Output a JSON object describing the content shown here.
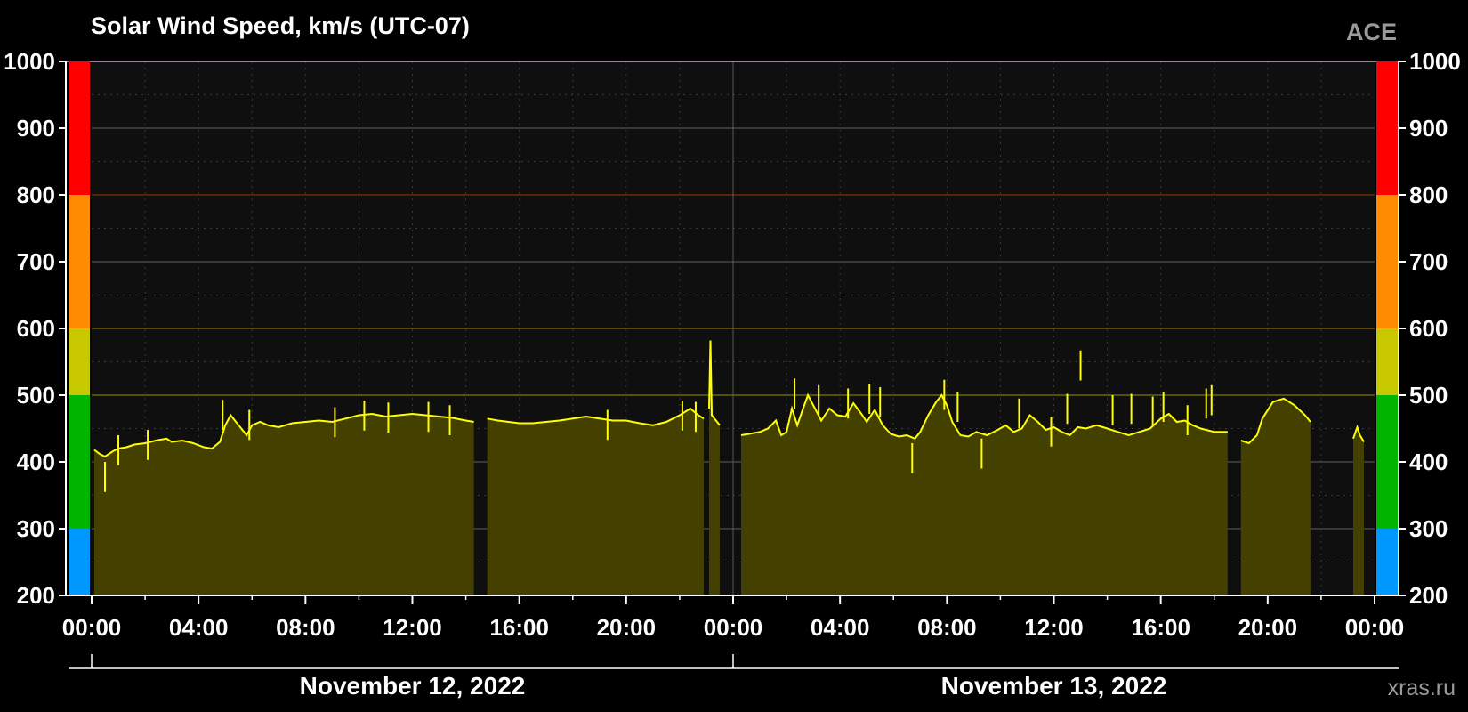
{
  "header": {
    "title": "Solar Wind Speed, km/s (UTC-07)",
    "source": "ACE",
    "credit": "xras.ru"
  },
  "chart_data": {
    "type": "area",
    "title": "Solar Wind Speed, km/s (UTC-07)",
    "xlabel": "",
    "ylabel": "",
    "ylim": [
      200,
      1000
    ],
    "xlim_hours": [
      0,
      48
    ],
    "yticks": [
      200,
      300,
      400,
      500,
      600,
      700,
      800,
      900,
      1000
    ],
    "xtick_labels": [
      "00:00",
      "04:00",
      "08:00",
      "12:00",
      "16:00",
      "20:00",
      "00:00",
      "04:00",
      "08:00",
      "12:00",
      "16:00",
      "20:00",
      "00:00"
    ],
    "date_labels": [
      "November 12, 2022",
      "November 13, 2022"
    ],
    "grid": true,
    "colors": {
      "line": "#ffff00",
      "fill": "#434000",
      "plot_bg": "#0f0f0f",
      "grid": "#505050",
      "threshold_800": "#8a2a00",
      "threshold_600": "#8a6a00",
      "threshold_500": "#7a7a00"
    },
    "thresholds": [
      500,
      600,
      800
    ],
    "color_bands": [
      {
        "from": 200,
        "to": 300,
        "color": "#0099ff"
      },
      {
        "from": 300,
        "to": 500,
        "color": "#00b400"
      },
      {
        "from": 500,
        "to": 600,
        "color": "#c8c800"
      },
      {
        "from": 600,
        "to": 800,
        "color": "#ff8c00"
      },
      {
        "from": 800,
        "to": 1000,
        "color": "#ff0000"
      }
    ],
    "series": [
      {
        "points": [
          [
            0.1,
            418
          ],
          [
            0.3,
            412
          ],
          [
            0.5,
            408
          ],
          [
            0.8,
            416
          ],
          [
            1.0,
            420
          ],
          [
            1.3,
            422
          ],
          [
            1.6,
            426
          ],
          [
            2.0,
            428
          ],
          [
            2.4,
            432
          ],
          [
            2.8,
            435
          ],
          [
            3.0,
            430
          ],
          [
            3.4,
            432
          ],
          [
            3.8,
            428
          ],
          [
            4.2,
            422
          ],
          [
            4.5,
            420
          ],
          [
            4.8,
            430
          ],
          [
            5.0,
            455
          ],
          [
            5.2,
            470
          ],
          [
            5.4,
            460
          ],
          [
            5.6,
            450
          ],
          [
            5.8,
            440
          ],
          [
            6.0,
            455
          ],
          [
            6.3,
            460
          ],
          [
            6.6,
            455
          ],
          [
            7.0,
            452
          ],
          [
            7.5,
            458
          ],
          [
            8.0,
            460
          ],
          [
            8.5,
            462
          ],
          [
            9.0,
            460
          ],
          [
            9.5,
            465
          ],
          [
            10.0,
            470
          ],
          [
            10.5,
            472
          ],
          [
            11.0,
            468
          ],
          [
            11.5,
            470
          ],
          [
            12.0,
            472
          ],
          [
            12.5,
            470
          ],
          [
            13.0,
            468
          ],
          [
            13.5,
            466
          ],
          [
            14.0,
            462
          ],
          [
            14.3,
            460
          ]
        ]
      },
      {
        "points": [
          [
            14.8,
            465
          ],
          [
            15.2,
            462
          ],
          [
            15.6,
            460
          ],
          [
            16.0,
            458
          ],
          [
            16.5,
            458
          ],
          [
            17.0,
            460
          ],
          [
            17.5,
            462
          ],
          [
            18.0,
            465
          ],
          [
            18.5,
            468
          ],
          [
            19.0,
            465
          ],
          [
            19.5,
            462
          ],
          [
            20.0,
            462
          ],
          [
            20.5,
            458
          ],
          [
            21.0,
            455
          ],
          [
            21.5,
            460
          ],
          [
            22.0,
            470
          ],
          [
            22.4,
            480
          ],
          [
            22.7,
            470
          ],
          [
            22.9,
            465
          ]
        ]
      },
      {
        "points": [
          [
            23.1,
            480
          ],
          [
            23.15,
            582
          ],
          [
            23.2,
            470
          ],
          [
            23.5,
            455
          ]
        ]
      },
      {
        "points": [
          [
            24.3,
            440
          ],
          [
            24.6,
            442
          ],
          [
            25.0,
            445
          ],
          [
            25.3,
            450
          ],
          [
            25.6,
            462
          ],
          [
            25.8,
            440
          ],
          [
            26.0,
            445
          ],
          [
            26.2,
            480
          ],
          [
            26.4,
            455
          ],
          [
            26.6,
            478
          ],
          [
            26.8,
            500
          ],
          [
            27.0,
            485
          ],
          [
            27.3,
            462
          ],
          [
            27.6,
            480
          ],
          [
            27.9,
            470
          ],
          [
            28.2,
            468
          ],
          [
            28.5,
            488
          ],
          [
            28.8,
            472
          ],
          [
            29.0,
            460
          ],
          [
            29.3,
            478
          ],
          [
            29.6,
            455
          ],
          [
            29.9,
            442
          ],
          [
            30.2,
            438
          ],
          [
            30.5,
            440
          ],
          [
            30.8,
            435
          ],
          [
            31.0,
            445
          ],
          [
            31.3,
            470
          ],
          [
            31.6,
            490
          ],
          [
            31.8,
            500
          ],
          [
            32.0,
            485
          ],
          [
            32.2,
            460
          ],
          [
            32.5,
            440
          ],
          [
            32.8,
            438
          ],
          [
            33.1,
            445
          ],
          [
            33.5,
            440
          ],
          [
            33.9,
            448
          ],
          [
            34.2,
            455
          ],
          [
            34.5,
            445
          ],
          [
            34.8,
            450
          ],
          [
            35.1,
            470
          ],
          [
            35.4,
            460
          ],
          [
            35.7,
            448
          ],
          [
            36.0,
            452
          ],
          [
            36.3,
            445
          ],
          [
            36.6,
            440
          ],
          [
            36.9,
            452
          ],
          [
            37.2,
            450
          ],
          [
            37.6,
            455
          ],
          [
            38.0,
            450
          ],
          [
            38.4,
            445
          ],
          [
            38.8,
            440
          ],
          [
            39.2,
            445
          ],
          [
            39.6,
            450
          ],
          [
            40.0,
            465
          ],
          [
            40.3,
            472
          ],
          [
            40.6,
            460
          ],
          [
            40.9,
            462
          ],
          [
            41.2,
            455
          ],
          [
            41.5,
            450
          ],
          [
            42.0,
            445
          ],
          [
            42.5,
            445
          ]
        ]
      },
      {
        "points": [
          [
            43.0,
            432
          ],
          [
            43.3,
            428
          ],
          [
            43.6,
            440
          ],
          [
            43.8,
            465
          ],
          [
            44.2,
            490
          ],
          [
            44.6,
            495
          ],
          [
            45.0,
            485
          ],
          [
            45.4,
            470
          ],
          [
            45.6,
            460
          ]
        ]
      },
      {
        "points": [
          [
            47.2,
            435
          ],
          [
            47.35,
            452
          ],
          [
            47.45,
            440
          ],
          [
            47.6,
            430
          ]
        ]
      }
    ],
    "spikes": [
      [
        0.5,
        400
      ],
      [
        1.0,
        440
      ],
      [
        2.1,
        448
      ],
      [
        4.9,
        493
      ],
      [
        5.9,
        478
      ],
      [
        9.1,
        482
      ],
      [
        10.2,
        492
      ],
      [
        11.1,
        489
      ],
      [
        12.6,
        490
      ],
      [
        13.4,
        485
      ],
      [
        19.3,
        478
      ],
      [
        22.1,
        492
      ],
      [
        22.6,
        490
      ],
      [
        26.3,
        525
      ],
      [
        27.2,
        515
      ],
      [
        28.3,
        510
      ],
      [
        29.1,
        517
      ],
      [
        29.5,
        512
      ],
      [
        30.7,
        428
      ],
      [
        31.9,
        523
      ],
      [
        32.4,
        505
      ],
      [
        33.3,
        435
      ],
      [
        34.7,
        495
      ],
      [
        35.9,
        468
      ],
      [
        36.5,
        502
      ],
      [
        37.0,
        567
      ],
      [
        38.2,
        500
      ],
      [
        38.9,
        502
      ],
      [
        39.7,
        498
      ],
      [
        40.1,
        505
      ],
      [
        41.0,
        485
      ],
      [
        41.7,
        510
      ],
      [
        41.9,
        515
      ]
    ]
  }
}
